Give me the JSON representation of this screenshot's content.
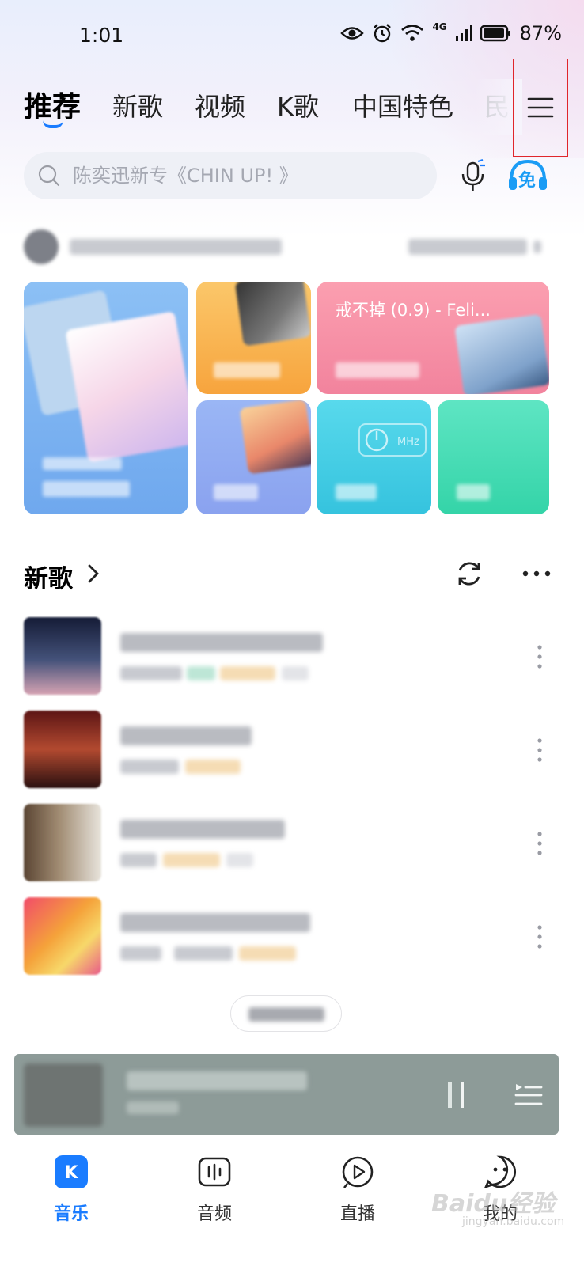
{
  "status_bar": {
    "time": "1:01",
    "network": "4G",
    "battery": "87%"
  },
  "tabs": [
    {
      "label": "推荐",
      "active": true
    },
    {
      "label": "新歌"
    },
    {
      "label": "视频"
    },
    {
      "label": "K歌"
    },
    {
      "label": "中国特色"
    },
    {
      "label": "民"
    }
  ],
  "search": {
    "placeholder": "陈奕迅新专《CHIN UP! 》"
  },
  "free_badge": "免",
  "cards": {
    "featured_song": "戒不掉 (0.9) - Feli..."
  },
  "new_songs_section": {
    "title": "新歌"
  },
  "songs": [
    {
      "cover_color": "#2b3555"
    },
    {
      "cover_color": "#7a2424"
    },
    {
      "cover_color": "#6b5a4a"
    },
    {
      "cover_color": "#e8a63a"
    }
  ],
  "bottom_nav": [
    {
      "label": "音乐",
      "active": true
    },
    {
      "label": "音频"
    },
    {
      "label": "直播"
    },
    {
      "label": "我的"
    }
  ],
  "watermark": {
    "main": "Baidu经验",
    "sub": "jingyan.baidu.com"
  },
  "colors": {
    "accent": "#1a7cff",
    "highlight_box": "#e0262b"
  }
}
